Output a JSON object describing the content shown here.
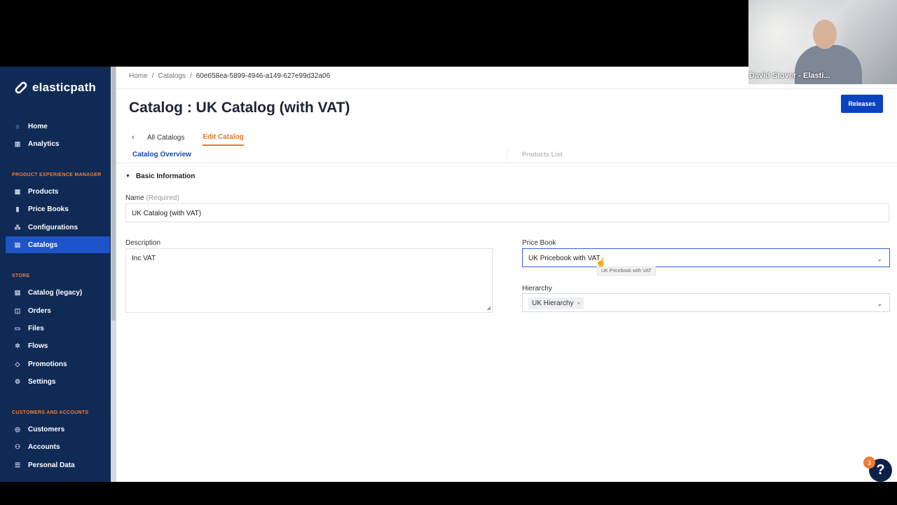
{
  "brand": {
    "name": "elasticpath"
  },
  "sidebar": {
    "items_top": [
      {
        "label": "Home",
        "icon": "home-icon"
      },
      {
        "label": "Analytics",
        "icon": "analytics-icon"
      }
    ],
    "sections": [
      {
        "title": "PRODUCT EXPERIENCE MANAGER",
        "items": [
          {
            "label": "Products",
            "icon": "products-icon"
          },
          {
            "label": "Price Books",
            "icon": "price-books-icon"
          },
          {
            "label": "Configurations",
            "icon": "configurations-icon"
          },
          {
            "label": "Catalogs",
            "icon": "catalogs-icon",
            "active": true
          }
        ]
      },
      {
        "title": "STORE",
        "items": [
          {
            "label": "Catalog (legacy)",
            "icon": "catalog-legacy-icon"
          },
          {
            "label": "Orders",
            "icon": "orders-icon"
          },
          {
            "label": "Files",
            "icon": "files-icon"
          },
          {
            "label": "Flows",
            "icon": "flows-icon"
          },
          {
            "label": "Promotions",
            "icon": "promotions-icon"
          },
          {
            "label": "Settings",
            "icon": "settings-icon"
          }
        ]
      },
      {
        "title": "CUSTOMERS AND ACCOUNTS",
        "items": [
          {
            "label": "Customers",
            "icon": "customers-icon"
          },
          {
            "label": "Accounts",
            "icon": "accounts-icon"
          },
          {
            "label": "Personal Data",
            "icon": "personal-data-icon"
          }
        ]
      }
    ]
  },
  "breadcrumb": {
    "home": "Home",
    "sep": "/",
    "catalogs": "Catalogs",
    "current": "60e658ea-5899-4946-a149-627e99d32a06"
  },
  "header": {
    "title": "Catalog : UK Catalog (with VAT)",
    "releases_label": "Releases"
  },
  "tabs": {
    "all": "All Catalogs",
    "edit": "Edit Catalog"
  },
  "subtabs": {
    "overview": "Catalog Overview",
    "products": "Products List"
  },
  "form": {
    "section_title": "Basic Information",
    "name_label": "Name",
    "name_required": "(Required)",
    "name_value": "UK Catalog (with VAT)",
    "description_label": "Description",
    "description_value": "Inc VAT",
    "pricebook_label": "Price Book",
    "pricebook_value": "UK Pricebook with VAT",
    "pricebook_tooltip": "UK Pricebook with VAT",
    "hierarchy_label": "Hierarchy",
    "hierarchy_chip": "UK Hierarchy",
    "chip_remove": "×"
  },
  "video": {
    "participant": "David Stover - Elasti..."
  },
  "help": {
    "badge_count": "3",
    "icon_label": "?"
  },
  "colors": {
    "sidebar_bg": "#0f2a55",
    "active_nav": "#1e54c8",
    "accent_orange": "#e17b2e",
    "primary_button": "#0a43c1"
  }
}
